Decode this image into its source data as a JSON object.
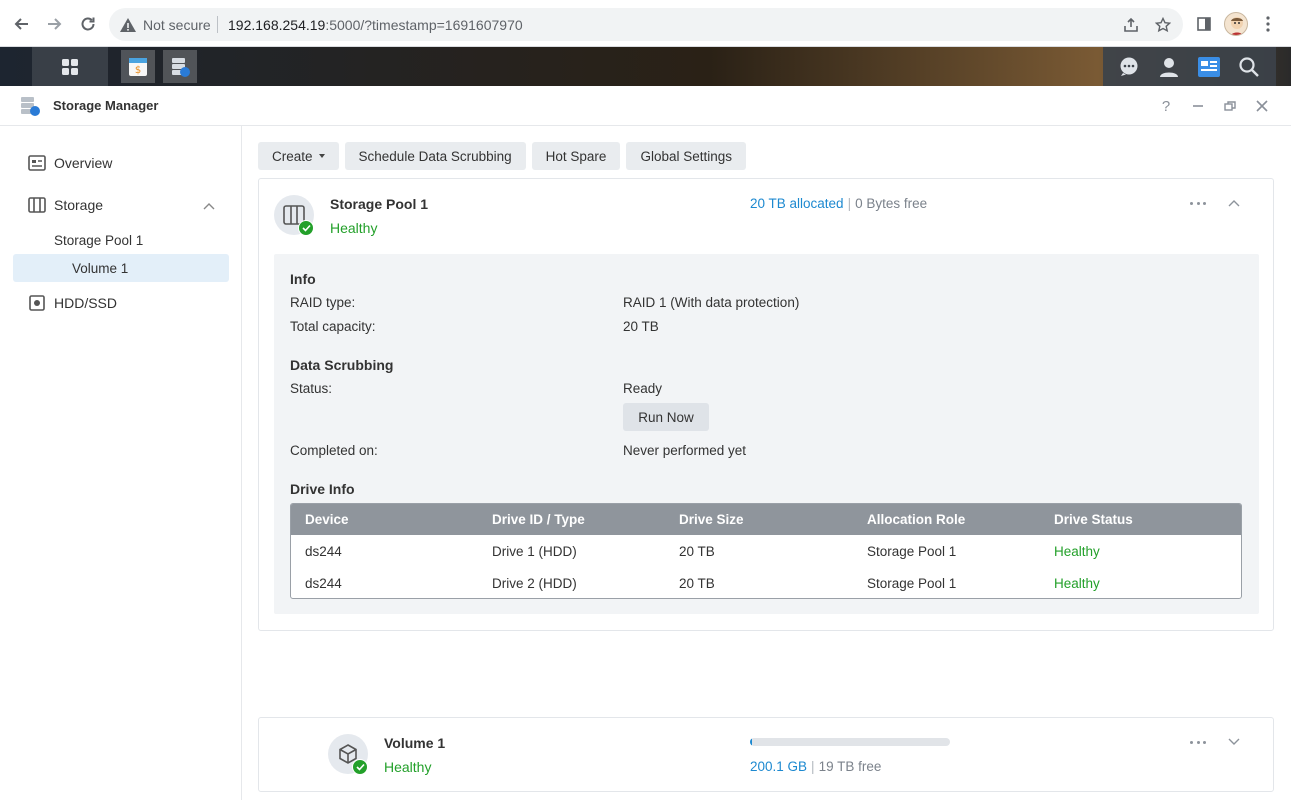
{
  "browser": {
    "security_label": "Not secure",
    "url_host": "192.168.254.19",
    "url_rest": ":5000/?timestamp=1691607970"
  },
  "window": {
    "title": "Storage Manager",
    "help_glyph": "?"
  },
  "sidebar": {
    "overview": "Overview",
    "storage": "Storage",
    "storage_pool": "Storage Pool 1",
    "volume": "Volume 1",
    "hdd_ssd": "HDD/SSD"
  },
  "toolbar": {
    "create": "Create",
    "schedule": "Schedule Data Scrubbing",
    "hot_spare": "Hot Spare",
    "global_settings": "Global Settings"
  },
  "pool": {
    "name": "Storage Pool 1",
    "status": "Healthy",
    "allocated": "20 TB allocated",
    "free": "0 Bytes free",
    "info_title": "Info",
    "raid_label": "RAID type:",
    "raid_value": "RAID 1 (With data protection)",
    "capacity_label": "Total capacity:",
    "capacity_value": "20 TB",
    "scrub_title": "Data Scrubbing",
    "status_label": "Status:",
    "status_value": "Ready",
    "run_now": "Run Now",
    "completed_label": "Completed on:",
    "completed_value": "Never performed yet",
    "drive_info_title": "Drive Info"
  },
  "drive_table": {
    "headers": [
      "Device",
      "Drive ID / Type",
      "Drive Size",
      "Allocation Role",
      "Drive Status"
    ],
    "rows": [
      [
        "ds244",
        "Drive 1 (HDD)",
        "20 TB",
        "Storage Pool 1",
        "Healthy"
      ],
      [
        "ds244",
        "Drive 2 (HDD)",
        "20 TB",
        "Storage Pool 1",
        "Healthy"
      ]
    ]
  },
  "volume": {
    "name": "Volume 1",
    "status": "Healthy",
    "used": "200.1 GB",
    "free": "19 TB free",
    "usage_fraction": 0.01
  },
  "colors": {
    "healthy": "#23a02a",
    "accent": "#1d89d0",
    "selected": "#e3eff9"
  }
}
